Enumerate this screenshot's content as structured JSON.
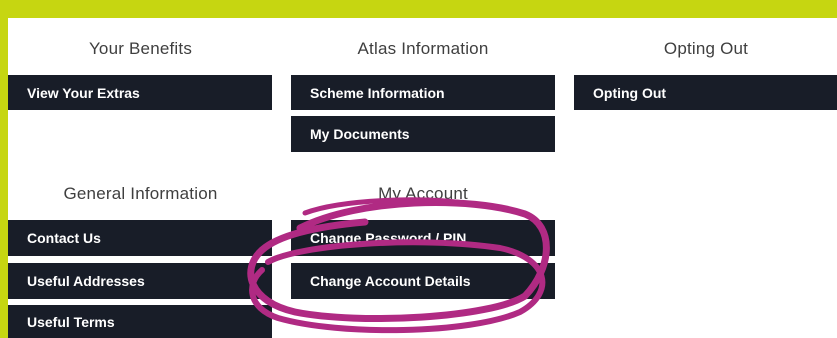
{
  "colors": {
    "frame": "#c6d611",
    "button_bg": "#181d28",
    "button_text": "#ffffff",
    "heading_text": "#3f3f3f",
    "annotation": "#b02a83"
  },
  "sections": {
    "your_benefits": {
      "heading": "Your Benefits",
      "buttons": [
        "View Your Extras"
      ]
    },
    "atlas_information": {
      "heading": "Atlas Information",
      "buttons": [
        "Scheme Information",
        "My Documents"
      ]
    },
    "opting_out": {
      "heading": "Opting Out",
      "buttons": [
        "Opting Out"
      ]
    },
    "general_information": {
      "heading": "General Information",
      "buttons": [
        "Contact Us",
        "Useful Addresses",
        "Useful Terms"
      ]
    },
    "my_account": {
      "heading": "My Account",
      "buttons": [
        "Change Password / PIN",
        "Change Account Details"
      ]
    }
  },
  "annotation": {
    "type": "hand-drawn-circle",
    "target": "Change Account Details"
  }
}
